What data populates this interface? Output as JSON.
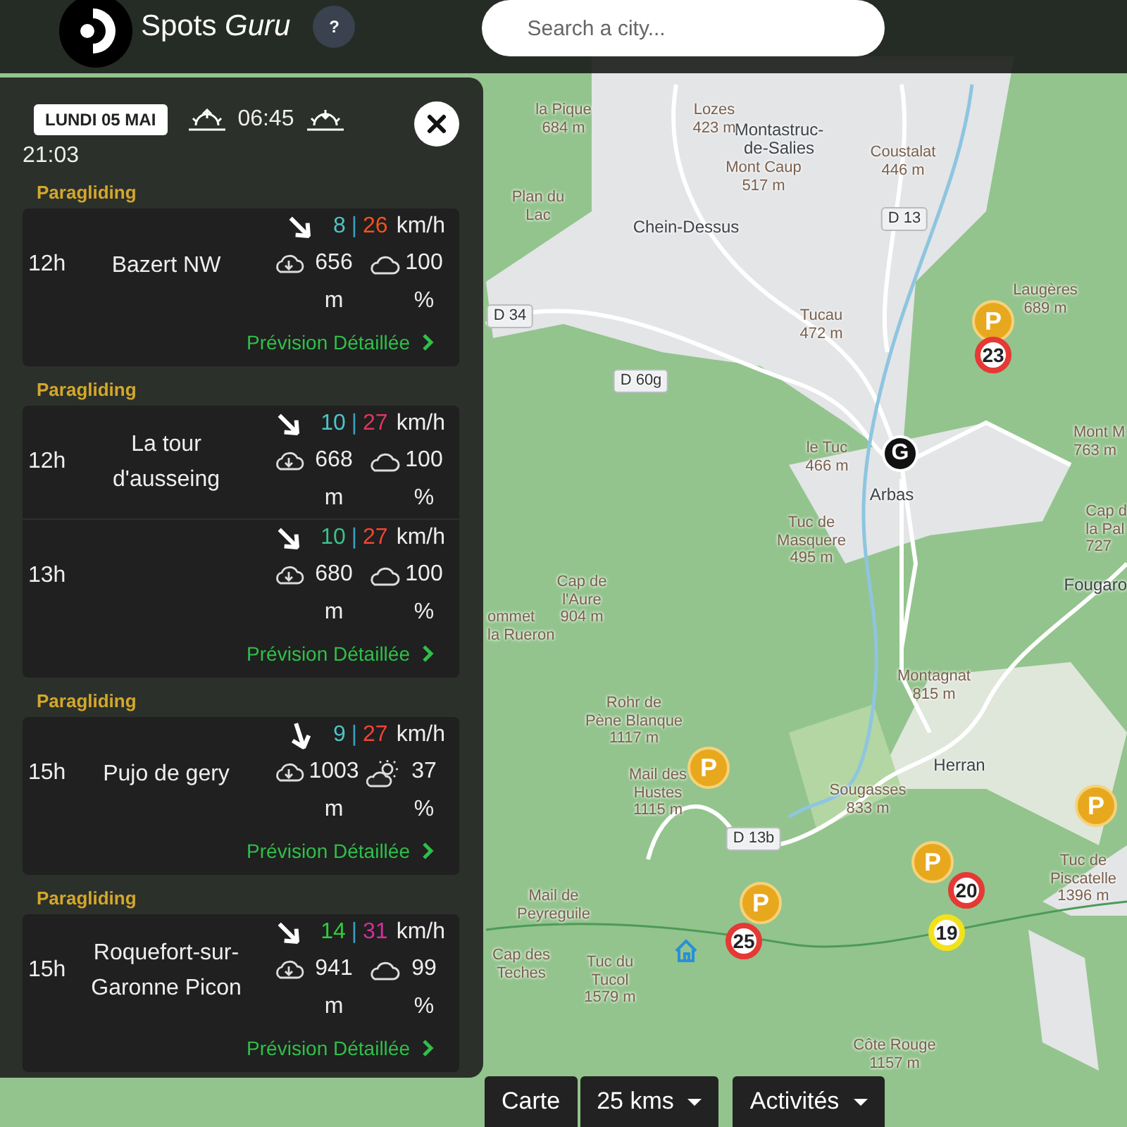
{
  "header": {
    "brand": "Spots *Guru*",
    "help": "?",
    "search": {
      "placeholder": "Search a city..."
    }
  },
  "panel": {
    "date": "LUNDI 05 MAI",
    "sunrise": "06:45",
    "sunset": "21:03",
    "groups": [
      {
        "activity": "Paragliding",
        "link": "Prévision Détaillée",
        "rows": [
          {
            "hour": "12h",
            "name": "Bazert NW",
            "arrow": {
              "kind": "NW"
            },
            "wind": [
              {
                "text": "8",
                "color": "#4fc3c7"
              },
              {
                "text": "|",
                "color": "#3a9fc0"
              },
              {
                "text": "26",
                "color": "#f4511e"
              }
            ],
            "unit": "km/h",
            "cloud_base": "656 m",
            "sky_icon": {
              "kind": "cloudy"
            },
            "cloud_cover": "100 %"
          }
        ]
      },
      {
        "activity": "Paragliding",
        "link": "Prévision Détaillée",
        "rows": [
          {
            "hour": "12h",
            "name": "La tour d'ausseing",
            "arrow": {
              "kind": "NW"
            },
            "wind": [
              {
                "text": "10",
                "color": "#4fc3c7"
              },
              {
                "text": "|",
                "color": "#3a9fc0"
              },
              {
                "text": "27",
                "color": "#e0365c"
              }
            ],
            "unit": "km/h",
            "cloud_base": "668 m",
            "sky_icon": {
              "kind": "cloudy"
            },
            "cloud_cover": "100 %"
          },
          {
            "hour": "13h",
            "arrow": {
              "kind": "NW"
            },
            "wind": [
              {
                "text": "10",
                "color": "#3dbf8a"
              },
              {
                "text": "|",
                "color": "#3a9fc0"
              },
              {
                "text": "27",
                "color": "#f44336"
              }
            ],
            "unit": "km/h",
            "cloud_base": "680 m",
            "sky_icon": {
              "kind": "cloudy"
            },
            "cloud_cover": "100 %"
          }
        ]
      },
      {
        "activity": "Paragliding",
        "link": "Prévision Détaillée",
        "rows": [
          {
            "hour": "15h",
            "name": "Pujo de gery",
            "arrow": {
              "kind": "NNW"
            },
            "wind": [
              {
                "text": "9",
                "color": "#4fc3c7"
              },
              {
                "text": "|",
                "color": "#3a9fc0"
              },
              {
                "text": "27",
                "color": "#f44336"
              }
            ],
            "unit": "km/h",
            "cloud_base": "1003 m",
            "sky_icon": {
              "kind": "partly_sunny"
            },
            "cloud_cover": "37 %"
          }
        ]
      },
      {
        "activity": "Paragliding",
        "link": "Prévision Détaillée",
        "rows": [
          {
            "hour": "15h",
            "name": "Roquefort-sur-Garonne Picon",
            "arrow": {
              "kind": "NW"
            },
            "wind": [
              {
                "text": "14",
                "color": "#2ecc40"
              },
              {
                "text": "|",
                "color": "#3a9fc0"
              },
              {
                "text": "31",
                "color": "#d0309a"
              }
            ],
            "unit": "km/h",
            "cloud_base": "941 m",
            "sky_icon": {
              "kind": "cloudy"
            },
            "cloud_cover": "99 %"
          }
        ]
      }
    ]
  },
  "map": {
    "labels": [
      {
        "kind": "place",
        "text": "Montastruc-\nde-Salies"
      },
      {
        "kind": "peak",
        "text": "la Pique\n684 m"
      },
      {
        "kind": "peak",
        "text": "Lozes\n423 m"
      },
      {
        "kind": "peak",
        "text": "Coustalat\n446 m"
      },
      {
        "kind": "peak",
        "text": "Mont Caup\n517 m"
      },
      {
        "kind": "peak",
        "text": "Plan du\nLac"
      },
      {
        "kind": "place",
        "text": "Chein-Dessus"
      },
      {
        "kind": "road",
        "text": "D 13"
      },
      {
        "kind": "peak",
        "text": "Laugères\n689 m"
      },
      {
        "kind": "road",
        "text": "D 34"
      },
      {
        "kind": "peak",
        "text": "Tucau\n472 m"
      },
      {
        "kind": "road",
        "text": "D 60g"
      },
      {
        "kind": "peak",
        "text": "Mont M\n763 m"
      },
      {
        "kind": "peak",
        "text": "le Tuc\n466 m"
      },
      {
        "kind": "place",
        "text": "Arbas"
      },
      {
        "kind": "peak",
        "text": "Tuc de\nMasquere\n495 m"
      },
      {
        "kind": "peak",
        "text": "Cap d\nla Pal\n727"
      },
      {
        "kind": "peak",
        "text": "Cap de\nl'Aure\n904 m"
      },
      {
        "kind": "place",
        "text": "Fougaro"
      },
      {
        "kind": "peak",
        "text": "ommet\nla Rueron"
      },
      {
        "kind": "peak",
        "text": "Montagnat\n815 m"
      },
      {
        "kind": "peak",
        "text": "Rohr de\nPène Blanque\n1117 m"
      },
      {
        "kind": "peak",
        "text": "Mail des\nHustes\n1115 m"
      },
      {
        "kind": "place",
        "text": "Herran"
      },
      {
        "kind": "peak",
        "text": "Sougasses\n833 m"
      },
      {
        "kind": "road",
        "text": "D 13b"
      },
      {
        "kind": "peak",
        "text": "Tuc de\nPiscatelle\n1396 m"
      },
      {
        "kind": "peak",
        "text": "Mail de\nPeyreguile"
      },
      {
        "kind": "peak",
        "text": "Cap des\nTeches"
      },
      {
        "kind": "peak",
        "text": "Tuc du\nTucol\n1579 m"
      },
      {
        "kind": "peak",
        "text": "Côte Rouge\n1157 m"
      }
    ],
    "markers": [
      {
        "kind": "parking",
        "text": "P"
      },
      {
        "kind": "wind",
        "text": "23",
        "color": "#e53935"
      },
      {
        "kind": "launch",
        "text": "G"
      },
      {
        "kind": "parking",
        "text": "P"
      },
      {
        "kind": "parking",
        "text": "P"
      },
      {
        "kind": "parking",
        "text": "P"
      },
      {
        "kind": "parking",
        "text": "P"
      },
      {
        "kind": "wind",
        "text": "20",
        "color": "#e53935"
      },
      {
        "kind": "wind",
        "text": "19",
        "color": "#f2e21c"
      },
      {
        "kind": "wind",
        "text": "25",
        "color": "#e53935"
      },
      {
        "kind": "shelter"
      }
    ]
  },
  "toolbar": [
    {
      "label": "Carte",
      "dropdown": false
    },
    {
      "label": "25 kms",
      "dropdown": true
    },
    {
      "label": "Activités",
      "dropdown": true
    }
  ]
}
